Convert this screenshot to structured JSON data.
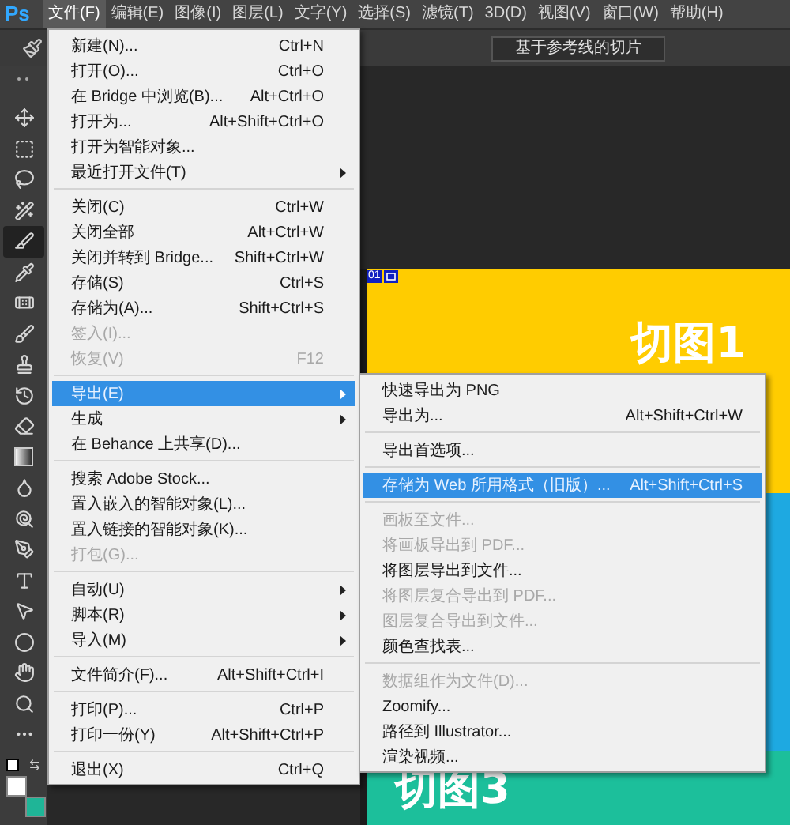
{
  "menu_bar": {
    "logo": "Ps",
    "items": [
      {
        "label": "文件(F)",
        "selected": true
      },
      {
        "label": "编辑(E)",
        "selected": false
      },
      {
        "label": "图像(I)",
        "selected": false
      },
      {
        "label": "图层(L)",
        "selected": false
      },
      {
        "label": "文字(Y)",
        "selected": false
      },
      {
        "label": "选择(S)",
        "selected": false
      },
      {
        "label": "滤镜(T)",
        "selected": false
      },
      {
        "label": "3D(D)",
        "selected": false
      },
      {
        "label": "视图(V)",
        "selected": false
      },
      {
        "label": "窗口(W)",
        "selected": false
      },
      {
        "label": "帮助(H)",
        "selected": false
      }
    ]
  },
  "options_bar": {
    "button": "基于参考线的切片"
  },
  "tools": [
    {
      "kind": "move",
      "selected": false
    },
    {
      "kind": "marquee",
      "selected": false
    },
    {
      "kind": "lasso",
      "selected": false
    },
    {
      "kind": "quick-select",
      "selected": false
    },
    {
      "kind": "slice",
      "selected": true
    },
    {
      "kind": "eyedropper",
      "selected": false
    },
    {
      "kind": "healing",
      "selected": false
    },
    {
      "kind": "brush",
      "selected": false
    },
    {
      "kind": "stamp",
      "selected": false
    },
    {
      "kind": "history",
      "selected": false
    },
    {
      "kind": "eraser",
      "selected": false
    },
    {
      "kind": "gradient",
      "selected": false
    },
    {
      "kind": "blur",
      "selected": false
    },
    {
      "kind": "dodge",
      "selected": false
    },
    {
      "kind": "pen",
      "selected": false
    },
    {
      "kind": "type",
      "selected": false
    },
    {
      "kind": "path-select",
      "selected": false
    },
    {
      "kind": "shape",
      "selected": false
    },
    {
      "kind": "hand",
      "selected": false
    },
    {
      "kind": "zoom",
      "selected": false
    },
    {
      "kind": "more",
      "selected": false
    }
  ],
  "color_swatches": [
    {
      "kind": "foreground",
      "color": "#ffffff"
    },
    {
      "kind": "background",
      "color": "#1fb597"
    }
  ],
  "document": {
    "slice_label": "01",
    "bands": [
      {
        "color": "#ffcc00",
        "title": "切图1"
      },
      {
        "color": "#1ea9e1"
      },
      {
        "color": "#1cbf9b",
        "title": "切图3"
      }
    ]
  },
  "file_menu": {
    "sections": [
      [
        {
          "label": "新建(N)...",
          "shortcut": "Ctrl+N",
          "disabled": false,
          "selected": false,
          "has_submenu": false
        },
        {
          "label": "打开(O)...",
          "shortcut": "Ctrl+O",
          "disabled": false,
          "selected": false,
          "has_submenu": false
        },
        {
          "label": "在 Bridge 中浏览(B)...",
          "shortcut": "Alt+Ctrl+O",
          "disabled": false,
          "selected": false,
          "has_submenu": false
        },
        {
          "label": "打开为...",
          "shortcut": "Alt+Shift+Ctrl+O",
          "disabled": false,
          "selected": false,
          "has_submenu": false
        },
        {
          "label": "打开为智能对象...",
          "disabled": false,
          "selected": false,
          "has_submenu": false
        },
        {
          "label": "最近打开文件(T)",
          "disabled": false,
          "selected": false,
          "has_submenu": true
        }
      ],
      [
        {
          "label": "关闭(C)",
          "shortcut": "Ctrl+W",
          "disabled": false,
          "selected": false,
          "has_submenu": false
        },
        {
          "label": "关闭全部",
          "shortcut": "Alt+Ctrl+W",
          "disabled": false,
          "selected": false,
          "has_submenu": false
        },
        {
          "label": "关闭并转到 Bridge...",
          "shortcut": "Shift+Ctrl+W",
          "disabled": false,
          "selected": false,
          "has_submenu": false
        },
        {
          "label": "存储(S)",
          "shortcut": "Ctrl+S",
          "disabled": false,
          "selected": false,
          "has_submenu": false
        },
        {
          "label": "存储为(A)...",
          "shortcut": "Shift+Ctrl+S",
          "disabled": false,
          "selected": false,
          "has_submenu": false
        },
        {
          "label": "签入(I)...",
          "disabled": true,
          "selected": false,
          "has_submenu": false
        },
        {
          "label": "恢复(V)",
          "shortcut": "F12",
          "disabled": true,
          "selected": false,
          "has_submenu": false
        }
      ],
      [
        {
          "label": "导出(E)",
          "disabled": false,
          "selected": true,
          "has_submenu": true
        },
        {
          "label": "生成",
          "disabled": false,
          "selected": false,
          "has_submenu": true
        },
        {
          "label": "在 Behance 上共享(D)...",
          "disabled": false,
          "selected": false,
          "has_submenu": false
        }
      ],
      [
        {
          "label": "搜索 Adobe Stock...",
          "disabled": false,
          "selected": false,
          "has_submenu": false
        },
        {
          "label": "置入嵌入的智能对象(L)...",
          "disabled": false,
          "selected": false,
          "has_submenu": false
        },
        {
          "label": "置入链接的智能对象(K)...",
          "disabled": false,
          "selected": false,
          "has_submenu": false
        },
        {
          "label": "打包(G)...",
          "disabled": true,
          "selected": false,
          "has_submenu": false
        }
      ],
      [
        {
          "label": "自动(U)",
          "disabled": false,
          "selected": false,
          "has_submenu": true
        },
        {
          "label": "脚本(R)",
          "disabled": false,
          "selected": false,
          "has_submenu": true
        },
        {
          "label": "导入(M)",
          "disabled": false,
          "selected": false,
          "has_submenu": true
        }
      ],
      [
        {
          "label": "文件简介(F)...",
          "shortcut": "Alt+Shift+Ctrl+I",
          "disabled": false,
          "selected": false,
          "has_submenu": false
        }
      ],
      [
        {
          "label": "打印(P)...",
          "shortcut": "Ctrl+P",
          "disabled": false,
          "selected": false,
          "has_submenu": false
        },
        {
          "label": "打印一份(Y)",
          "shortcut": "Alt+Shift+Ctrl+P",
          "disabled": false,
          "selected": false,
          "has_submenu": false
        }
      ],
      [
        {
          "label": "退出(X)",
          "shortcut": "Ctrl+Q",
          "disabled": false,
          "selected": false,
          "has_submenu": false
        }
      ]
    ]
  },
  "export_submenu": {
    "sections": [
      [
        {
          "label": "快速导出为 PNG",
          "disabled": false,
          "selected": false
        },
        {
          "label": "导出为...",
          "shortcut": "Alt+Shift+Ctrl+W",
          "disabled": false,
          "selected": false
        }
      ],
      [
        {
          "label": "导出首选项...",
          "disabled": false,
          "selected": false
        }
      ],
      [
        {
          "label": "存储为 Web 所用格式（旧版）...",
          "shortcut": "Alt+Shift+Ctrl+S",
          "disabled": false,
          "selected": true
        }
      ],
      [
        {
          "label": "画板至文件...",
          "disabled": true,
          "selected": false
        },
        {
          "label": "将画板导出到 PDF...",
          "disabled": true,
          "selected": false
        },
        {
          "label": "将图层导出到文件...",
          "disabled": false,
          "selected": false
        },
        {
          "label": "将图层复合导出到 PDF...",
          "disabled": true,
          "selected": false
        },
        {
          "label": "图层复合导出到文件...",
          "disabled": true,
          "selected": false
        },
        {
          "label": "颜色查找表...",
          "disabled": false,
          "selected": false
        }
      ],
      [
        {
          "label": "数据组作为文件(D)...",
          "disabled": true,
          "selected": false
        },
        {
          "label": "Zoomify...",
          "disabled": false,
          "selected": false
        },
        {
          "label": "路径到 Illustrator...",
          "disabled": false,
          "selected": false
        },
        {
          "label": "渲染视频...",
          "disabled": false,
          "selected": false
        }
      ]
    ]
  }
}
